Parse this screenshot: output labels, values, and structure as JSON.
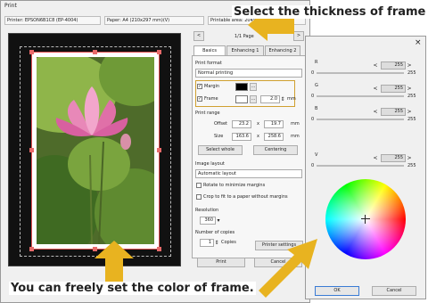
{
  "window": {
    "title": "Print",
    "printer": "Printer: EPSON6B1C8 (EP-4004)",
    "paper": "Paper: A4 (210x297 mm)(V)",
    "printable_area": "Printable area: 204x291(mm)",
    "page_indicator": "1/1 Page"
  },
  "tabs": [
    "Basics",
    "Enhancing 1",
    "Enhancing 2"
  ],
  "print_format": {
    "label": "Print format",
    "value": "Normal printing"
  },
  "margin": {
    "label": "Margin",
    "checked": true
  },
  "frame": {
    "label": "Frame",
    "checked": true,
    "value": "2.0",
    "unit": "mm"
  },
  "print_range": {
    "label": "Print range",
    "offset_label": "Offset",
    "offset_x": "23.2",
    "offset_y": "19.7",
    "size_label": "Size",
    "size_w": "163.6",
    "size_h": "258.6",
    "unit": "mm",
    "x_sign": "x"
  },
  "buttons": {
    "select_whole": "Select whole",
    "centering": "Centering",
    "printer_settings": "Printer settings",
    "print": "Print",
    "cancel": "Cancel"
  },
  "image_layout": {
    "label": "Image layout",
    "value": "Automatic layout",
    "rotate": "Rotate to minimize margins",
    "crop": "Crop to fit to a paper without margins"
  },
  "resolution": {
    "label": "Resolution",
    "value": "360"
  },
  "copies": {
    "label": "Number of copies",
    "value": "1",
    "unit": "Copies"
  },
  "color_dialog": {
    "close": "×",
    "sliders": [
      {
        "name": "R",
        "value": "255",
        "min": "0",
        "max": "255"
      },
      {
        "name": "G",
        "value": "255",
        "min": "0",
        "max": "255"
      },
      {
        "name": "B",
        "value": "255",
        "min": "0",
        "max": "255"
      },
      {
        "name": "V",
        "value": "255",
        "min": "0",
        "max": "255"
      }
    ],
    "ok": "OK",
    "cancel": "Cancel"
  },
  "callouts": {
    "thickness": "Select the thickness of frame",
    "color": "You can freely set the color of frame."
  }
}
